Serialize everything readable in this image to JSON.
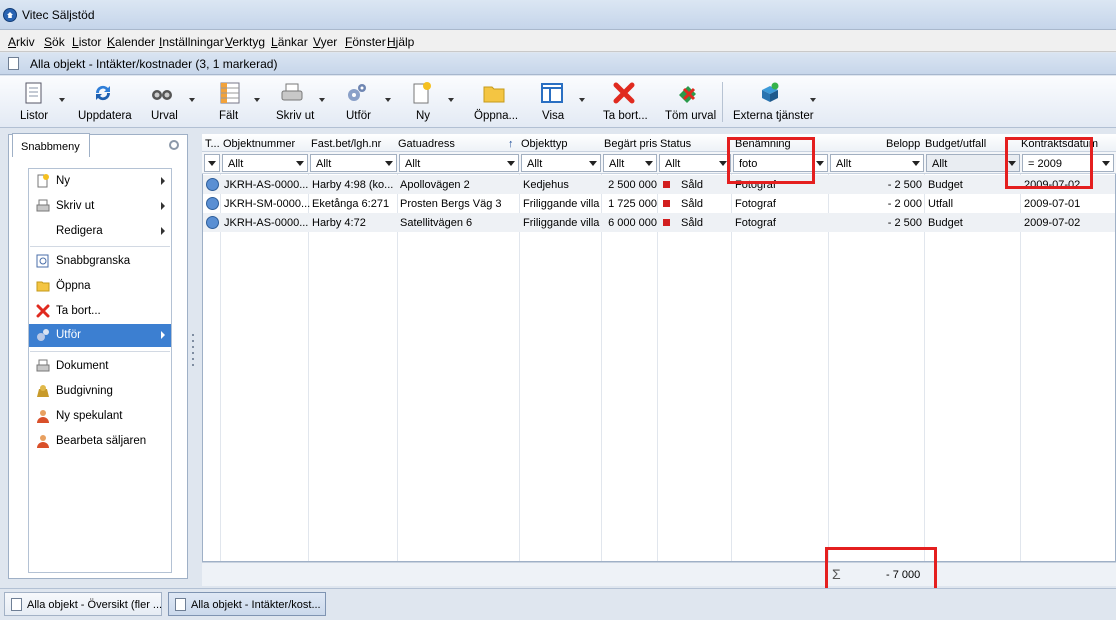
{
  "window": {
    "title": "Vitec Säljstöd"
  },
  "menubar": [
    "Arkiv",
    "Sök",
    "Listor",
    "Kalender",
    "Inställningar",
    "Verktyg",
    "Länkar",
    "Vyer",
    "Fönster",
    "Hjälp"
  ],
  "document": {
    "title": "Alla objekt - Intäkter/kostnader (3, 1 markerad)"
  },
  "toolbar": [
    {
      "label": "Listor",
      "icon": "list-icon"
    },
    {
      "label": "Uppdatera",
      "icon": "refresh-icon"
    },
    {
      "label": "Urval",
      "icon": "binoculars-icon"
    },
    {
      "label": "Fält",
      "icon": "fields-icon"
    },
    {
      "label": "Skriv ut",
      "icon": "printer-icon"
    },
    {
      "label": "Utför",
      "icon": "gears-icon"
    },
    {
      "label": "Ny",
      "icon": "new-document-icon"
    },
    {
      "label": "Öppna...",
      "icon": "folder-icon"
    },
    {
      "label": "Visa",
      "icon": "view-icon"
    },
    {
      "label": "Ta bort...",
      "icon": "delete-icon"
    },
    {
      "label": "Töm urval",
      "icon": "clear-selection-icon"
    },
    {
      "label": "Externa tjänster",
      "icon": "external-services-icon"
    }
  ],
  "leftpanel": {
    "tab": "Snabbmeny",
    "items": [
      {
        "label": "Ny",
        "icon": "new-icon"
      },
      {
        "label": "Skriv ut",
        "icon": "printer-icon"
      },
      {
        "label": "Redigera",
        "icon": ""
      },
      {
        "label": "Snabbgranska",
        "icon": "preview-icon"
      },
      {
        "label": "Öppna",
        "icon": "folder-icon"
      },
      {
        "label": "Ta bort...",
        "icon": "delete-icon"
      },
      {
        "label": "Utför",
        "icon": "gears-icon"
      },
      {
        "label": "Dokument",
        "icon": "document-icon"
      },
      {
        "label": "Budgivning",
        "icon": "bid-icon"
      },
      {
        "label": "Ny spekulant",
        "icon": "person-icon"
      },
      {
        "label": "Bearbeta säljaren",
        "icon": "person-icon"
      }
    ]
  },
  "grid": {
    "columns": [
      "T...",
      "Objektnummer",
      "Fast.bet/lgh.nr",
      "Gatuadress",
      "Objekttyp",
      "Begärt pris",
      "Status",
      "Benämning",
      "Belopp",
      "Budget/utfall",
      "Kontraktsdatum"
    ],
    "filters": [
      "",
      "Allt",
      "Allt",
      "Allt",
      "Allt",
      "Allt",
      "Allt",
      "foto",
      "Allt",
      "Allt",
      "= 2009"
    ],
    "rows": [
      {
        "objektnummer": "JKRH-AS-0000...",
        "fastbet": "Harby 4:98 (ko...",
        "gatuadress": "Apollovägen 2",
        "objekttyp": "Kedjehus",
        "begart_pris": "2 500 000",
        "status": "Såld",
        "benamning": "Fotograf",
        "belopp": "- 2 500",
        "budget": "Budget",
        "kontraktsdatum": "2009-07-02"
      },
      {
        "objektnummer": "JKRH-SM-0000...",
        "fastbet": "Eketånga 6:271",
        "gatuadress": "Prosten Bergs Väg 3",
        "objekttyp": "Friliggande villa",
        "begart_pris": "1 725 000",
        "status": "Såld",
        "benamning": "Fotograf",
        "belopp": "- 2 000",
        "budget": "Utfall",
        "kontraktsdatum": "2009-07-01"
      },
      {
        "objektnummer": "JKRH-AS-0000...",
        "fastbet": "Harby 4:72",
        "gatuadress": "Satellitvägen 6",
        "objekttyp": "Friliggande villa",
        "begart_pris": "6 000 000",
        "status": "Såld",
        "benamning": "Fotograf",
        "belopp": "- 2 500",
        "budget": "Budget",
        "kontraktsdatum": "2009-07-02"
      }
    ],
    "sum": {
      "symbol": "Σ",
      "value": "- 7 000"
    }
  },
  "taskbar": [
    "Alla objekt - Översikt (fler ...",
    "Alla objekt - Intäkter/kost..."
  ]
}
